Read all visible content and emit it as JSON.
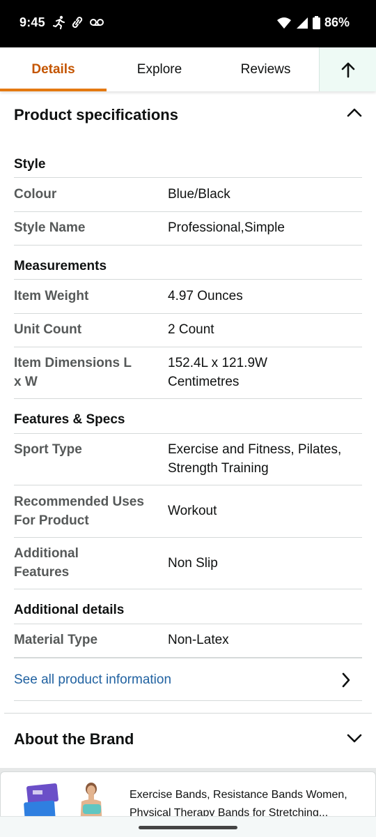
{
  "status": {
    "time": "9:45",
    "battery": "86%"
  },
  "tabs": [
    {
      "label": "Details"
    },
    {
      "label": "Explore"
    },
    {
      "label": "Reviews"
    }
  ],
  "specs": {
    "header": "Product specifications",
    "groups": {
      "style": {
        "title": "Style",
        "rows": [
          {
            "label": "Colour",
            "value": "Blue/Black"
          },
          {
            "label": "Style Name",
            "value": "Professional,Simple"
          }
        ]
      },
      "measurements": {
        "title": "Measurements",
        "rows": [
          {
            "label": "Item Weight",
            "value": "4.97 Ounces"
          },
          {
            "label": "Unit Count",
            "value": "2 Count"
          },
          {
            "label": "Item Dimensions L x W",
            "value": "152.4L x 121.9W Centimetres"
          }
        ]
      },
      "features": {
        "title": "Features & Specs",
        "rows": [
          {
            "label": "Sport Type",
            "value": "Exercise and Fitness, Pilates, Strength Training"
          },
          {
            "label": "Recommended Uses For Product",
            "value": "Workout"
          },
          {
            "label": "Additional Features",
            "value": "Non Slip"
          }
        ]
      },
      "additional": {
        "title": "Additional details",
        "rows": [
          {
            "label": "Material Type",
            "value": "Non-Latex"
          }
        ]
      }
    },
    "see_all": "See all product information"
  },
  "brand": {
    "header": "About the Brand"
  },
  "card": {
    "title": "Exercise Bands, Resistance Bands Women, Physical Therapy Bands for Stretching..."
  }
}
